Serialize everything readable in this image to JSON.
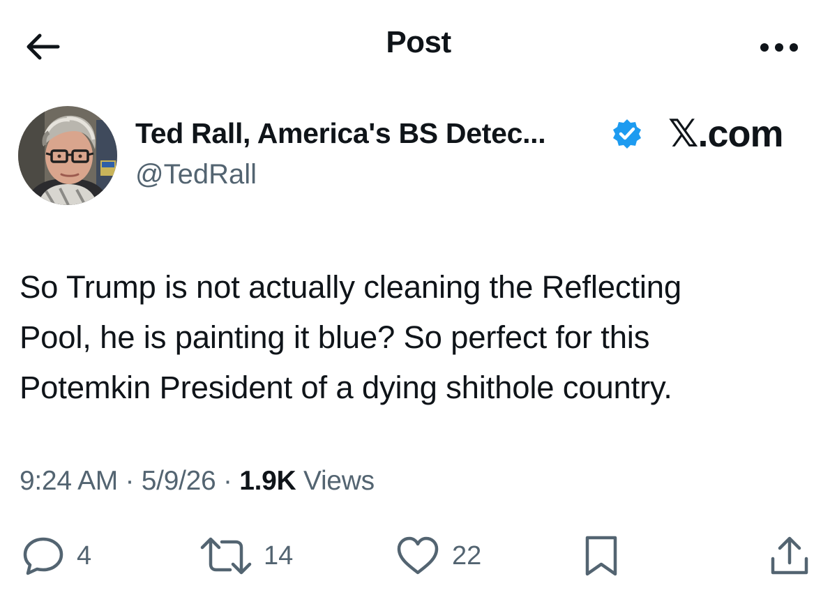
{
  "header": {
    "title": "Post",
    "back_icon": "arrow-left-icon",
    "more_icon": "more-horizontal-icon"
  },
  "author": {
    "display_name": "Ted Rall, America's BS Detec...",
    "handle": "@TedRall",
    "verified": true,
    "verified_color": "#1d9bf0",
    "avatar_icon": "user-avatar-photo"
  },
  "site_label": "𝕏.com",
  "post": {
    "lines": [
      "So Trump is not actually cleaning the Reflecting",
      "Pool, he is painting it blue? So perfect for this",
      "Potemkin President of a dying shithole country."
    ]
  },
  "meta": {
    "time": "9:24 AM",
    "date": "5/9/26",
    "separator": "·",
    "views_count": "1.9K",
    "views_label": "Views"
  },
  "actions": {
    "replies": "4",
    "reposts": "14",
    "likes": "22"
  },
  "colors": {
    "text_primary": "#0f1419",
    "text_secondary": "#536471",
    "accent": "#1d9bf0"
  }
}
